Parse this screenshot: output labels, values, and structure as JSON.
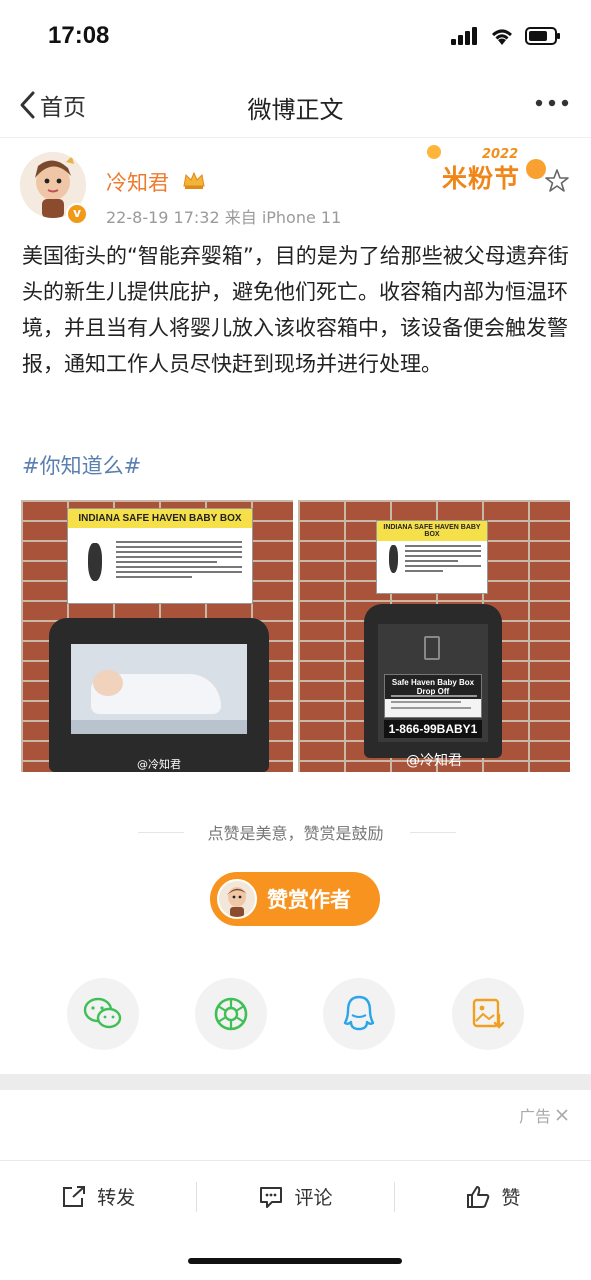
{
  "status_bar": {
    "time": "17:08"
  },
  "nav": {
    "back_label": "首页",
    "title": "微博正文"
  },
  "post": {
    "author": "冷知君",
    "meta": "22-8-19 17:32  来自 iPhone 11",
    "badge_year": "2022",
    "badge_text": "米粉节",
    "text": "美国街头的“智能弃婴箱”，目的是为了给那些被父母遗弃街头的新生儿提供庇护，避免他们死亡。收容箱内部为恒温环境，并且当有人将婴儿放入该收容箱中，该设备便会触发警报，通知工作人员尽快赶到现场并进行处理。",
    "hashtag": "#你知道么#",
    "images": [
      {
        "sign_title": "INDIANA SAFE HAVEN BABY BOX",
        "watermark": "@冷知君"
      },
      {
        "sign_title": "INDIANA SAFE HAVEN BABY BOX",
        "panel_title": "Safe Haven Baby Box Drop Off",
        "phone": "1-866-99BABY1",
        "watermark": "@冷知君"
      }
    ]
  },
  "reward": {
    "hint": "点赞是美意，赞赏是鼓励",
    "button_label": "赞赏作者"
  },
  "share": [
    {
      "icon": "wechat-icon"
    },
    {
      "icon": "moments-icon"
    },
    {
      "icon": "qq-icon"
    },
    {
      "icon": "save-image-icon"
    }
  ],
  "ad": {
    "label": "广告"
  },
  "toolbar": {
    "repost_label": "转发",
    "comment_label": "评论",
    "like_label": "赞"
  },
  "colors": {
    "accent": "#f7931e",
    "author": "#f07a2c",
    "hashtag": "#5b7fb0"
  }
}
